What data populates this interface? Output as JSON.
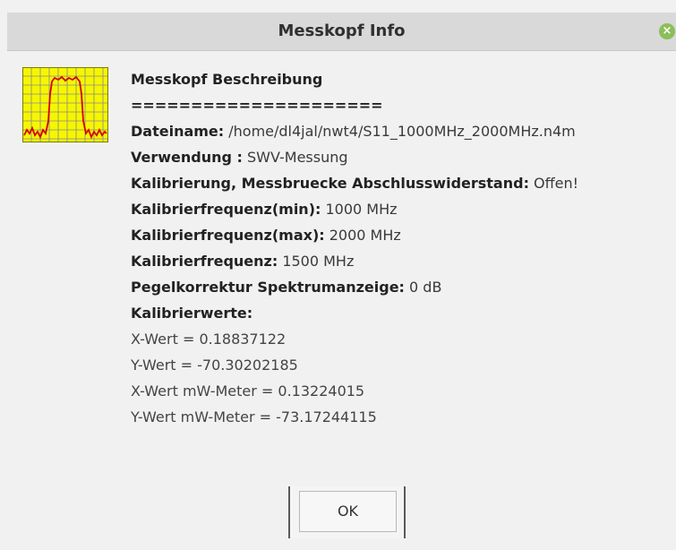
{
  "window": {
    "title": "Messkopf Info",
    "close_icon": "close-icon"
  },
  "icon": {
    "name": "frequency-plot-icon",
    "colors": {
      "background": "#f6f600",
      "grid": "#8a8a8a",
      "curve": "#d40000",
      "border": "#7a7a00"
    }
  },
  "info": {
    "heading": "Messkopf Beschreibung",
    "separator": "=====================",
    "dateiname_label": "Dateiname:",
    "dateiname_value": " /home/dl4jal/nwt4/S11_1000MHz_2000MHz.n4m",
    "verwendung_label": "Verwendung :",
    "verwendung_value": " SWV-Messung",
    "kalibrierung_label": "Kalibrierung, Messbruecke Abschlusswiderstand:",
    "kalibrierung_value": " Offen!",
    "freq_min_label": "Kalibrierfrequenz(min):",
    "freq_min_value": " 1000 MHz",
    "freq_max_label": "Kalibrierfrequenz(max):",
    "freq_max_value": " 2000 MHz",
    "freq_label": "Kalibrierfrequenz:",
    "freq_value": " 1500 MHz",
    "pegel_label": "Pegelkorrektur Spektrumanzeige:",
    "pegel_value": " 0 dB",
    "kalibrierwerte_label": "Kalibrierwerte:",
    "x_wert": "X-Wert = 0.18837122",
    "y_wert": "Y-Wert = -70.30202185",
    "x_wert_mw": "X-Wert mW-Meter = 0.13224015",
    "y_wert_mw": "Y-Wert mW-Meter = -73.17244115"
  },
  "buttons": {
    "ok_label": "OK"
  }
}
